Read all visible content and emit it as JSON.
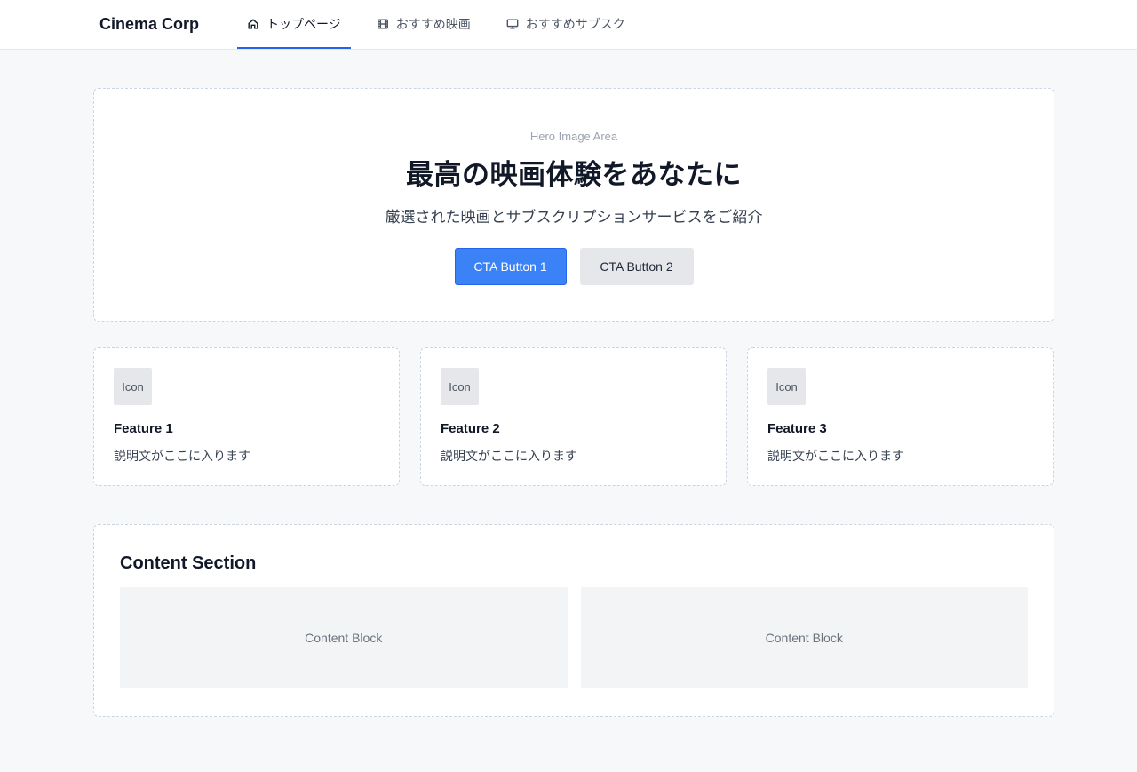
{
  "nav": {
    "brand": "Cinema Corp",
    "tabs": [
      {
        "label": "トップページ",
        "icon": "home-icon",
        "active": true
      },
      {
        "label": "おすすめ映画",
        "icon": "film-icon",
        "active": false
      },
      {
        "label": "おすすめサブスク",
        "icon": "monitor-icon",
        "active": false
      }
    ]
  },
  "hero": {
    "label": "Hero Image Area",
    "title": "最高の映画体験をあなたに",
    "subtitle": "厳選された映画とサブスクリプションサービスをご紹介",
    "cta1": "CTA Button 1",
    "cta2": "CTA Button 2"
  },
  "features": [
    {
      "icon_label": "Icon",
      "title": "Feature 1",
      "desc": "説明文がここに入ります"
    },
    {
      "icon_label": "Icon",
      "title": "Feature 2",
      "desc": "説明文がここに入ります"
    },
    {
      "icon_label": "Icon",
      "title": "Feature 3",
      "desc": "説明文がここに入ります"
    }
  ],
  "content": {
    "title": "Content Section",
    "blocks": [
      "Content Block",
      "Content Block"
    ]
  },
  "colors": {
    "accent": "#3b82f6",
    "active_tab_underline": "#2563eb",
    "border_dashed": "#cbd5e1"
  }
}
